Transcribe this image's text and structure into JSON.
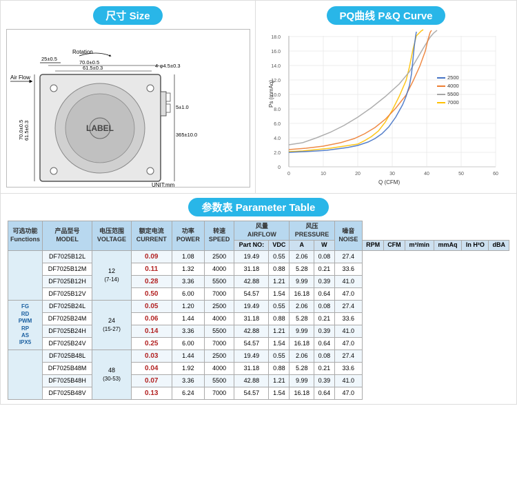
{
  "size_section": {
    "title": "尺寸 Size"
  },
  "pq_section": {
    "title": "PQ曲线 P&Q Curve",
    "legend": [
      {
        "label": "2500",
        "color": "#4472c4"
      },
      {
        "label": "4000",
        "color": "#ed7d31"
      },
      {
        "label": "5500",
        "color": "#a5a5a5"
      },
      {
        "label": "7000",
        "color": "#ffc000"
      }
    ],
    "x_label": "Q (CFM)",
    "y_label": "Ps (mmAq)",
    "x_max": 60,
    "y_max": 18
  },
  "param_section": {
    "title": "参数表 Parameter Table"
  },
  "table": {
    "headers_row1": [
      "可选功能\nFunctions",
      "产品型号\nMODEL",
      "电压范围\nVOLTAGE",
      "额定电流\nCURRENT",
      "功率\nPOWER",
      "转速\nSPEED",
      "风量\nAIRFLOW",
      "",
      "风压\nPRESSURE",
      "",
      "噪音\nNOISE"
    ],
    "headers_row2": [
      "",
      "Part NO:",
      "VDC",
      "A",
      "W",
      "RPM",
      "CFM",
      "m³/min",
      "mmAq",
      "In H²O",
      "dBA"
    ],
    "functions_labels": [
      "",
      "",
      "FG\nRD\nPWM\nRP\nAS\nIPX5",
      "",
      "",
      "",
      "",
      "",
      ""
    ],
    "voltage_labels": [
      "12\n(7-14)",
      "",
      "",
      "",
      "24\n(15-27)",
      "",
      "",
      "",
      "48\n(30-53)",
      "",
      ""
    ],
    "rows": [
      {
        "model": "DF7025B12L",
        "voltage_main": "12",
        "voltage_range": "(7-14)",
        "current": "0.09",
        "power": "1.08",
        "speed": "2500",
        "cfm": "19.49",
        "m3min": "0.55",
        "mmaq": "2.06",
        "inh2o": "0.08",
        "dba": "27.4"
      },
      {
        "model": "DF7025B12M",
        "voltage_main": "",
        "voltage_range": "",
        "current": "0.11",
        "power": "1.32",
        "speed": "4000",
        "cfm": "31.18",
        "m3min": "0.88",
        "mmaq": "5.28",
        "inh2o": "0.21",
        "dba": "33.6"
      },
      {
        "model": "DF7025B12H",
        "voltage_main": "",
        "voltage_range": "",
        "current": "0.28",
        "power": "3.36",
        "speed": "5500",
        "cfm": "42.88",
        "m3min": "1.21",
        "mmaq": "9.99",
        "inh2o": "0.39",
        "dba": "41.0"
      },
      {
        "model": "DF7025B12V",
        "voltage_main": "",
        "voltage_range": "",
        "current": "0.50",
        "power": "6.00",
        "speed": "7000",
        "cfm": "54.57",
        "m3min": "1.54",
        "mmaq": "16.18",
        "inh2o": "0.64",
        "dba": "47.0"
      },
      {
        "model": "DF7025B24L",
        "voltage_main": "24",
        "voltage_range": "(15-27)",
        "current": "0.05",
        "power": "1.20",
        "speed": "2500",
        "cfm": "19.49",
        "m3min": "0.55",
        "mmaq": "2.06",
        "inh2o": "0.08",
        "dba": "27.4"
      },
      {
        "model": "DF7025B24M",
        "voltage_main": "",
        "voltage_range": "",
        "current": "0.06",
        "power": "1.44",
        "speed": "4000",
        "cfm": "31.18",
        "m3min": "0.88",
        "mmaq": "5.28",
        "inh2o": "0.21",
        "dba": "33.6"
      },
      {
        "model": "DF7025B24H",
        "voltage_main": "",
        "voltage_range": "",
        "current": "0.14",
        "power": "3.36",
        "speed": "5500",
        "cfm": "42.88",
        "m3min": "1.21",
        "mmaq": "9.99",
        "inh2o": "0.39",
        "dba": "41.0"
      },
      {
        "model": "DF7025B24V",
        "voltage_main": "",
        "voltage_range": "",
        "current": "0.25",
        "power": "6.00",
        "speed": "7000",
        "cfm": "54.57",
        "m3min": "1.54",
        "mmaq": "16.18",
        "inh2o": "0.64",
        "dba": "47.0"
      },
      {
        "model": "DF7025B48L",
        "voltage_main": "48",
        "voltage_range": "(30-53)",
        "current": "0.03",
        "power": "1.44",
        "speed": "2500",
        "cfm": "19.49",
        "m3min": "0.55",
        "mmaq": "2.06",
        "inh2o": "0.08",
        "dba": "27.4"
      },
      {
        "model": "DF7025B48M",
        "voltage_main": "",
        "voltage_range": "",
        "current": "0.04",
        "power": "1.92",
        "speed": "4000",
        "cfm": "31.18",
        "m3min": "0.88",
        "mmaq": "5.28",
        "inh2o": "0.21",
        "dba": "33.6"
      },
      {
        "model": "DF7025B48H",
        "voltage_main": "",
        "voltage_range": "",
        "current": "0.07",
        "power": "3.36",
        "speed": "5500",
        "cfm": "42.88",
        "m3min": "1.21",
        "mmaq": "9.99",
        "inh2o": "0.39",
        "dba": "41.0"
      },
      {
        "model": "DF7025B48V",
        "voltage_main": "",
        "voltage_range": "",
        "current": "0.13",
        "power": "6.24",
        "speed": "7000",
        "cfm": "54.57",
        "m3min": "1.54",
        "mmaq": "16.18",
        "inh2o": "0.64",
        "dba": "47.0"
      }
    ]
  }
}
